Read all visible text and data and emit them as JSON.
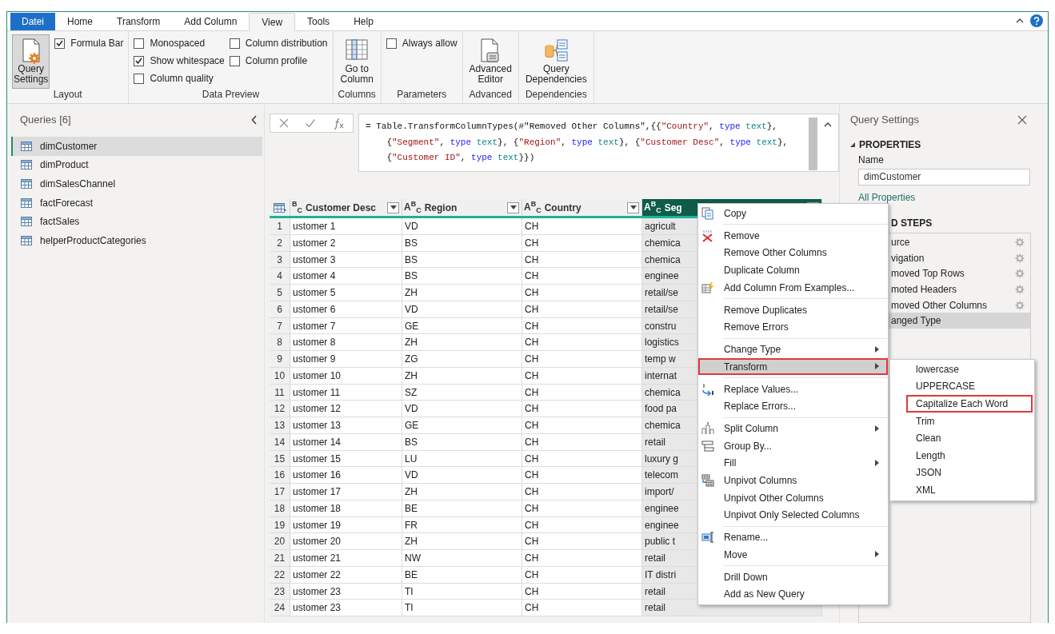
{
  "tabs": [
    {
      "label": "Datei",
      "kind": "file",
      "selected": false
    },
    {
      "label": "Home",
      "kind": "tab",
      "selected": false
    },
    {
      "label": "Transform",
      "kind": "tab",
      "selected": false
    },
    {
      "label": "Add Column",
      "kind": "tab",
      "selected": false
    },
    {
      "label": "View",
      "kind": "tab",
      "selected": true
    },
    {
      "label": "Tools",
      "kind": "tab",
      "selected": false
    },
    {
      "label": "Help",
      "kind": "tab",
      "selected": false
    }
  ],
  "ribbon": {
    "groups": [
      {
        "label": "Layout",
        "items": [
          {
            "kind": "big-button",
            "label": "Query\nSettings",
            "pressed": true
          },
          {
            "kind": "checkbox",
            "label": "Formula Bar",
            "checked": true
          }
        ]
      },
      {
        "label": "Data Preview",
        "items": [
          {
            "kind": "checkbox",
            "label": "Monospaced",
            "checked": false
          },
          {
            "kind": "checkbox",
            "label": "Show whitespace",
            "checked": true
          },
          {
            "kind": "checkbox",
            "label": "Column quality",
            "checked": false
          },
          {
            "kind": "checkbox",
            "label": "Column distribution",
            "checked": false
          },
          {
            "kind": "checkbox",
            "label": "Column profile",
            "checked": false
          }
        ]
      },
      {
        "label": "Columns",
        "items": [
          {
            "kind": "big-button",
            "label": "Go to\nColumn",
            "pressed": false
          }
        ]
      },
      {
        "label": "Parameters",
        "items": [
          {
            "kind": "checkbox",
            "label": "Always allow",
            "checked": false
          }
        ]
      },
      {
        "label": "Advanced",
        "items": [
          {
            "kind": "big-button",
            "label": "Advanced\nEditor",
            "pressed": false
          }
        ]
      },
      {
        "label": "Dependencies",
        "items": [
          {
            "kind": "big-button",
            "label": "Query\nDependencies",
            "pressed": false
          }
        ]
      }
    ]
  },
  "queries": {
    "title": "Queries [6]",
    "items": [
      {
        "label": "dimCustomer",
        "selected": true
      },
      {
        "label": "dimProduct",
        "selected": false
      },
      {
        "label": "dimSalesChannel",
        "selected": false
      },
      {
        "label": "factForecast",
        "selected": false
      },
      {
        "label": "factSales",
        "selected": false
      },
      {
        "label": "helperProductCategories",
        "selected": false
      }
    ]
  },
  "formula": {
    "lines": [
      [
        {
          "kind": "plain",
          "text": "= Table.TransformColumnTypes(#\"Removed Other Columns\",{{"
        },
        {
          "kind": "string",
          "text": "\"Country\""
        },
        {
          "kind": "plain",
          "text": ", "
        },
        {
          "kind": "keyword",
          "text": "type"
        },
        {
          "kind": "type",
          "text": " text"
        },
        {
          "kind": "plain",
          "text": "},"
        }
      ],
      [
        {
          "kind": "plain",
          "text": "{"
        },
        {
          "kind": "string",
          "text": "\"Segment\""
        },
        {
          "kind": "plain",
          "text": ", "
        },
        {
          "kind": "keyword",
          "text": "type"
        },
        {
          "kind": "type",
          "text": " text"
        },
        {
          "kind": "plain",
          "text": "}, {"
        },
        {
          "kind": "string",
          "text": "\"Region\""
        },
        {
          "kind": "plain",
          "text": ", "
        },
        {
          "kind": "keyword",
          "text": "type"
        },
        {
          "kind": "type",
          "text": " text"
        },
        {
          "kind": "plain",
          "text": "}, {"
        },
        {
          "kind": "string",
          "text": "\"Customer Desc\""
        },
        {
          "kind": "plain",
          "text": ", "
        },
        {
          "kind": "keyword",
          "text": "type"
        },
        {
          "kind": "type",
          "text": " text"
        },
        {
          "kind": "plain",
          "text": "},"
        }
      ],
      [
        {
          "kind": "plain",
          "text": "{"
        },
        {
          "kind": "string",
          "text": "\"Customer ID\""
        },
        {
          "kind": "plain",
          "text": ", "
        },
        {
          "kind": "keyword",
          "text": "type"
        },
        {
          "kind": "type",
          "text": " text"
        },
        {
          "kind": "plain",
          "text": "}})"
        }
      ]
    ]
  },
  "grid": {
    "columns": [
      {
        "type_label": "$^{B}$$_{C}$",
        "label": "Customer Desc",
        "selected": false
      },
      {
        "type_label": "A$^{B}$$_{C}$",
        "label": "Region",
        "selected": false
      },
      {
        "type_label": "A$^{B}$$_{C}$",
        "label": "Country",
        "selected": false
      },
      {
        "type_label": "A$^{B}$$_{C}$",
        "label": "Seg",
        "selected": true
      }
    ],
    "rows": [
      {
        "number": "1",
        "cells": [
          "ustomer 1",
          "VD",
          "CH",
          "agricult"
        ]
      },
      {
        "number": "2",
        "cells": [
          "ustomer 2",
          "BS",
          "CH",
          "chemica"
        ]
      },
      {
        "number": "3",
        "cells": [
          "ustomer 3",
          "BS",
          "CH",
          "chemica"
        ]
      },
      {
        "number": "4",
        "cells": [
          "ustomer 4",
          "BS",
          "CH",
          "enginee"
        ]
      },
      {
        "number": "5",
        "cells": [
          "ustomer 5",
          "ZH",
          "CH",
          "retail/se"
        ]
      },
      {
        "number": "6",
        "cells": [
          "ustomer 6",
          "VD",
          "CH",
          "retail/se"
        ]
      },
      {
        "number": "7",
        "cells": [
          "ustomer 7",
          "GE",
          "CH",
          "constru"
        ]
      },
      {
        "number": "8",
        "cells": [
          "ustomer 8",
          "ZH",
          "CH",
          "logistics"
        ]
      },
      {
        "number": "9",
        "cells": [
          "ustomer 9",
          "ZG",
          "CH",
          "temp w"
        ]
      },
      {
        "number": "10",
        "cells": [
          "ustomer 10",
          "ZH",
          "CH",
          "internat"
        ]
      },
      {
        "number": "11",
        "cells": [
          "ustomer 11",
          "SZ",
          "CH",
          "chemica"
        ]
      },
      {
        "number": "12",
        "cells": [
          "ustomer 12",
          "VD",
          "CH",
          "food pa"
        ]
      },
      {
        "number": "13",
        "cells": [
          "ustomer 13",
          "GE",
          "CH",
          "chemica"
        ]
      },
      {
        "number": "14",
        "cells": [
          "ustomer 14",
          "BS",
          "CH",
          "retail"
        ]
      },
      {
        "number": "15",
        "cells": [
          "ustomer 15",
          "LU",
          "CH",
          "luxury g"
        ]
      },
      {
        "number": "16",
        "cells": [
          "ustomer 16",
          "VD",
          "CH",
          "telecom"
        ]
      },
      {
        "number": "17",
        "cells": [
          "ustomer 17",
          "ZH",
          "CH",
          "import/"
        ]
      },
      {
        "number": "18",
        "cells": [
          "ustomer 18",
          "BE",
          "CH",
          "enginee"
        ]
      },
      {
        "number": "19",
        "cells": [
          "ustomer 19",
          "FR",
          "CH",
          "enginee"
        ]
      },
      {
        "number": "20",
        "cells": [
          "ustomer 20",
          "ZH",
          "CH",
          "public t"
        ]
      },
      {
        "number": "21",
        "cells": [
          "ustomer 21",
          "NW",
          "CH",
          "retail"
        ]
      },
      {
        "number": "22",
        "cells": [
          "ustomer 22",
          "BE",
          "CH",
          "IT distri"
        ]
      },
      {
        "number": "23",
        "cells": [
          "ustomer 23",
          "TI",
          "CH",
          "retail"
        ]
      },
      {
        "number": "24",
        "cells": [
          "ustomer 23",
          "TI",
          "CH",
          "retail"
        ]
      }
    ]
  },
  "query_settings": {
    "title": "Query Settings",
    "properties_heading": "PROPERTIES",
    "name_label": "Name",
    "name_value": "dimCustomer",
    "all_properties": "All Properties",
    "steps_heading": "D STEPS",
    "steps": [
      {
        "label": "urce",
        "selected": false,
        "has_settings": true
      },
      {
        "label": "vigation",
        "selected": false,
        "has_settings": true
      },
      {
        "label": "moved Top Rows",
        "selected": false,
        "has_settings": true
      },
      {
        "label": "moted Headers",
        "selected": false,
        "has_settings": true
      },
      {
        "label": "moved Other Columns",
        "selected": false,
        "has_settings": true
      },
      {
        "label": "anged Type",
        "selected": true,
        "has_settings": false
      }
    ]
  },
  "context_menu": {
    "items": [
      {
        "kind": "item",
        "label": "Copy",
        "submenu": false,
        "highlighted": false,
        "boxed": false
      },
      {
        "kind": "separator"
      },
      {
        "kind": "item",
        "label": "Remove",
        "submenu": false,
        "highlighted": false,
        "boxed": false
      },
      {
        "kind": "item",
        "label": "Remove Other Columns",
        "submenu": false,
        "highlighted": false,
        "boxed": false
      },
      {
        "kind": "item",
        "label": "Duplicate Column",
        "submenu": false,
        "highlighted": false,
        "boxed": false
      },
      {
        "kind": "item",
        "label": "Add Column From Examples...",
        "submenu": false,
        "highlighted": false,
        "boxed": false
      },
      {
        "kind": "separator"
      },
      {
        "kind": "item",
        "label": "Remove Duplicates",
        "submenu": false,
        "highlighted": false,
        "boxed": false
      },
      {
        "kind": "item",
        "label": "Remove Errors",
        "submenu": false,
        "highlighted": false,
        "boxed": false
      },
      {
        "kind": "separator"
      },
      {
        "kind": "item",
        "label": "Change Type",
        "submenu": true,
        "highlighted": false,
        "boxed": false
      },
      {
        "kind": "item",
        "label": "Transform",
        "submenu": true,
        "highlighted": true,
        "boxed": true
      },
      {
        "kind": "separator"
      },
      {
        "kind": "item",
        "label": "Replace Values...",
        "submenu": false,
        "highlighted": false,
        "boxed": false
      },
      {
        "kind": "item",
        "label": "Replace Errors...",
        "submenu": false,
        "highlighted": false,
        "boxed": false
      },
      {
        "kind": "separator"
      },
      {
        "kind": "item",
        "label": "Split Column",
        "submenu": true,
        "highlighted": false,
        "boxed": false
      },
      {
        "kind": "item",
        "label": "Group By...",
        "submenu": false,
        "highlighted": false,
        "boxed": false
      },
      {
        "kind": "item",
        "label": "Fill",
        "submenu": true,
        "highlighted": false,
        "boxed": false
      },
      {
        "kind": "item",
        "label": "Unpivot Columns",
        "submenu": false,
        "highlighted": false,
        "boxed": false
      },
      {
        "kind": "item",
        "label": "Unpivot Other Columns",
        "submenu": false,
        "highlighted": false,
        "boxed": false
      },
      {
        "kind": "item",
        "label": "Unpivot Only Selected Columns",
        "submenu": false,
        "highlighted": false,
        "boxed": false
      },
      {
        "kind": "separator"
      },
      {
        "kind": "item",
        "label": "Rename...",
        "submenu": false,
        "highlighted": false,
        "boxed": false
      },
      {
        "kind": "item",
        "label": "Move",
        "submenu": true,
        "highlighted": false,
        "boxed": false
      },
      {
        "kind": "separator"
      },
      {
        "kind": "item",
        "label": "Drill Down",
        "submenu": false,
        "highlighted": false,
        "boxed": false
      },
      {
        "kind": "item",
        "label": "Add as New Query",
        "submenu": false,
        "highlighted": false,
        "boxed": false
      }
    ]
  },
  "submenu": {
    "items": [
      {
        "label": "lowercase",
        "boxed": false
      },
      {
        "label": "UPPERCASE",
        "boxed": false
      },
      {
        "label": "Capitalize Each Word",
        "boxed": true
      },
      {
        "label": "Trim",
        "boxed": false
      },
      {
        "label": "Clean",
        "boxed": false
      },
      {
        "label": "Length",
        "boxed": false
      },
      {
        "label": "JSON",
        "boxed": false
      },
      {
        "label": "XML",
        "boxed": false
      }
    ]
  }
}
